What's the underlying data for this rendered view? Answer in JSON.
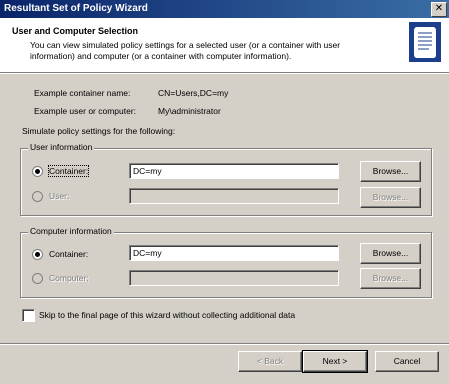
{
  "window": {
    "title": "Resultant Set of Policy Wizard",
    "close_glyph": "✕"
  },
  "header": {
    "title": "User and Computer Selection",
    "description": "You can view simulated policy settings for a selected user (or a container with user information) and computer (or a container with computer information)."
  },
  "examples": {
    "container_label": "Example container name:",
    "container_value": "CN=Users,DC=my",
    "user_label": "Example user or computer:",
    "user_value": "My\\administrator"
  },
  "simulate_label": "Simulate policy settings for the following:",
  "user_group": {
    "legend": "User information",
    "container_label": "Container:",
    "container_value": "DC=my",
    "user_label": "User:",
    "user_value": "",
    "browse1": "Browse...",
    "browse2": "Browse..."
  },
  "computer_group": {
    "legend": "Computer information",
    "container_label": "Container:",
    "container_value": "DC=my",
    "computer_label": "Computer:",
    "computer_value": "",
    "browse1": "Browse...",
    "browse2": "Browse..."
  },
  "skip_label": "Skip to the final page of this wizard without collecting additional data",
  "buttons": {
    "back": "< Back",
    "next": "Next >",
    "cancel": "Cancel"
  },
  "icon": "rsop-scroll-icon"
}
